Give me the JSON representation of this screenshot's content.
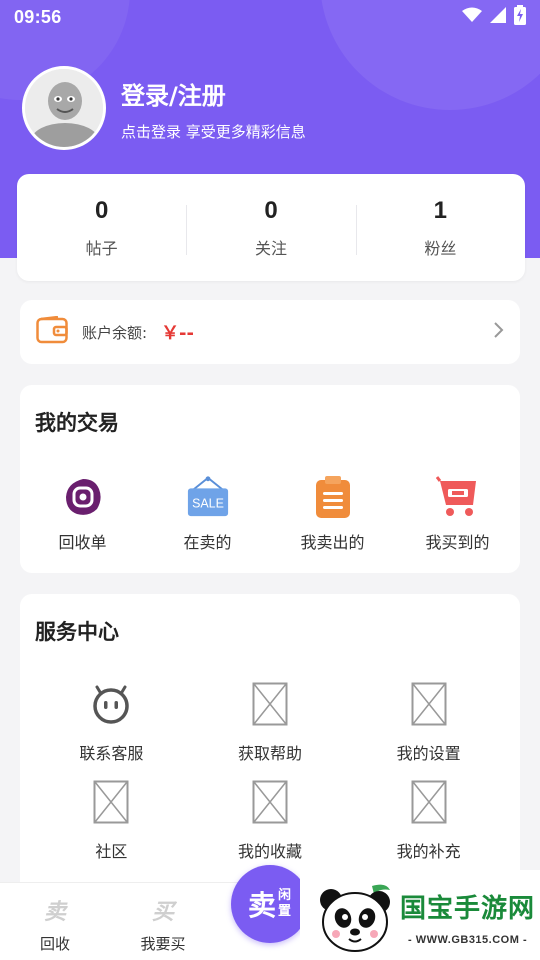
{
  "status_bar": {
    "time": "09:56",
    "icons": [
      "wifi-icon",
      "signal-icon",
      "battery-charging-icon"
    ]
  },
  "colors": {
    "brand": "#7b5cf2",
    "price": "#e53935",
    "wallet_icon": "#f08c3b"
  },
  "profile": {
    "title": "登录/注册",
    "subtitle": "点击登录 享受更多精彩信息"
  },
  "stats": [
    {
      "value": "0",
      "label": "帖子"
    },
    {
      "value": "0",
      "label": "关注"
    },
    {
      "value": "1",
      "label": "粉丝"
    }
  ],
  "wallet": {
    "label": "账户余额:",
    "amount": "￥--"
  },
  "trade": {
    "title": "我的交易",
    "items": [
      {
        "label": "回收单",
        "icon": "recycle-order-icon"
      },
      {
        "label": "在卖的",
        "icon": "sale-sign-icon",
        "badge": "SALE"
      },
      {
        "label": "我卖出的",
        "icon": "clipboard-icon"
      },
      {
        "label": "我买到的",
        "icon": "cart-icon"
      }
    ]
  },
  "service": {
    "title": "服务中心",
    "items": [
      {
        "label": "联系客服",
        "icon": "robot-face-icon"
      },
      {
        "label": "获取帮助",
        "icon": "placeholder-image-icon"
      },
      {
        "label": "我的设置",
        "icon": "placeholder-image-icon"
      },
      {
        "label": "社区",
        "icon": "placeholder-image-icon"
      },
      {
        "label": "我的收藏",
        "icon": "placeholder-image-icon"
      },
      {
        "label": "我的补充",
        "icon": "placeholder-image-icon"
      }
    ]
  },
  "tabbar": {
    "recycle": {
      "label": "回收",
      "glyph": "卖"
    },
    "buy": {
      "label": "我要买",
      "glyph": "买"
    },
    "sell": {
      "big": "卖",
      "small": "闲置"
    }
  },
  "watermark": {
    "title": "国宝手游网",
    "url": "- WWW.GB315.COM -"
  }
}
